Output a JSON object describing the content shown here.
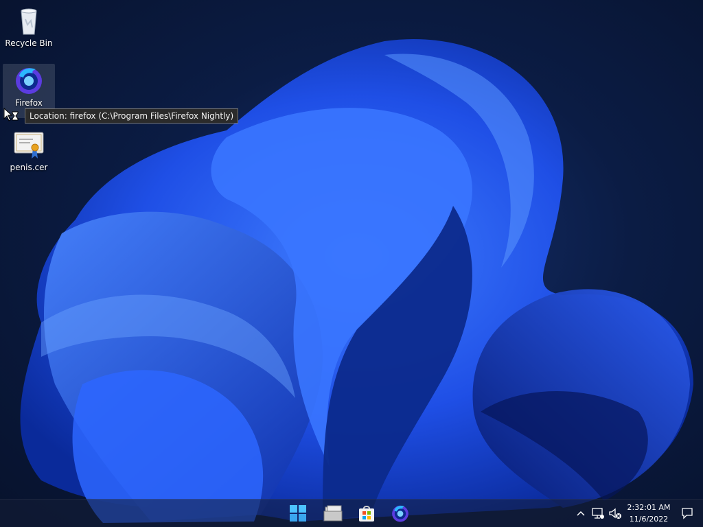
{
  "desktop": {
    "icons": [
      {
        "label": "Recycle Bin",
        "icon": "recycle-bin-icon"
      },
      {
        "label": "Firefox",
        "icon": "firefox-icon"
      },
      {
        "label": "penis.cer",
        "icon": "certificate-icon"
      }
    ],
    "tooltip": "Location: firefox (C:\\Program Files\\Firefox Nightly)"
  },
  "taskbar": {
    "apps": [
      {
        "name": "start",
        "icon": "windows-start-icon"
      },
      {
        "name": "file-explorer",
        "icon": "folder-icon"
      },
      {
        "name": "microsoft-store",
        "icon": "store-bag-icon"
      },
      {
        "name": "firefox",
        "icon": "firefox-icon"
      }
    ],
    "tray": {
      "icons": [
        "chevron-up-icon",
        "network-icon",
        "volume-muted-icon",
        "notification-icon"
      ],
      "time": "2:32:01 AM",
      "date": "11/6/2022"
    }
  },
  "colors": {
    "wallpaper_dark": "#07122c",
    "bloom_blue": "#1f4fe6",
    "tooltip_bg": "#2b2b2b"
  }
}
